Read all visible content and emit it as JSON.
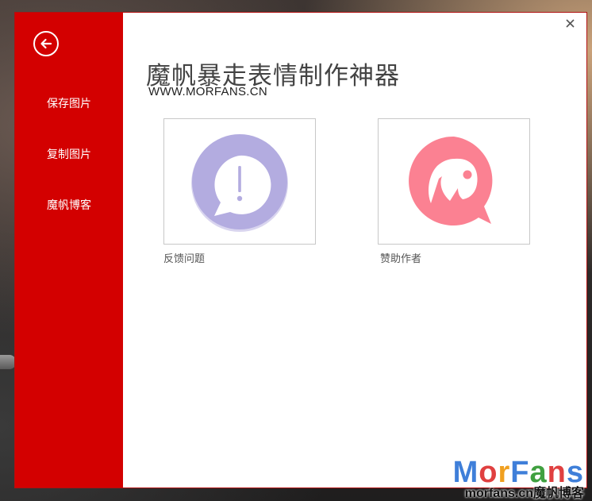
{
  "sidebar": {
    "back_icon": "arrow-left-circle-icon",
    "items": [
      {
        "label": "保存图片"
      },
      {
        "label": "复制图片"
      },
      {
        "label": "魔帆博客"
      }
    ]
  },
  "header": {
    "title": "魔帆暴走表情制作神器",
    "subtitle": "WWW.MORFANS.CN"
  },
  "tiles": [
    {
      "label": "反馈问题",
      "icon": "exclamation-speech-bubble-icon",
      "color": "#b3ace0"
    },
    {
      "label": "赞助作者",
      "icon": "pink-speech-bubble-icon",
      "color": "#fb8192"
    }
  ],
  "window": {
    "close_glyph": "×",
    "accent": "#d30000"
  },
  "watermark": {
    "logo_letters": [
      "M",
      "o",
      "r",
      "F",
      "a",
      "n",
      "s"
    ],
    "logo_colors": [
      "#3f7fd9",
      "#e04040",
      "#f0a020",
      "#3f7fd9",
      "#40a040",
      "#e04040",
      "#3f7fd9"
    ],
    "caption": "morfans.cn魔帆博客"
  }
}
